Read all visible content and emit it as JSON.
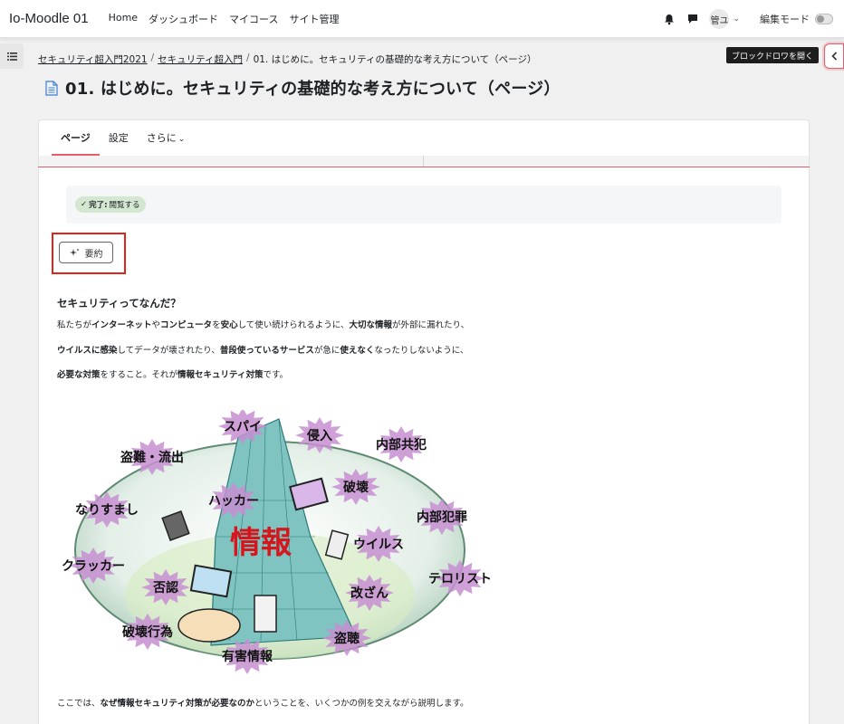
{
  "navbar": {
    "brand": "Io-Moodle 01",
    "links": [
      "Home",
      "ダッシュボード",
      "マイコース",
      "サイト管理"
    ],
    "avatar_text": "管ユ",
    "edit_mode_label": "編集モード"
  },
  "drawer": {
    "block_tooltip": "ブロックドロワを開く"
  },
  "breadcrumb": {
    "items": [
      "セキュリティ超入門2021",
      "セキュリティ超入門",
      "01. はじめに。セキュリティの基礎的な考え方について（ページ）"
    ],
    "separator": "/"
  },
  "page": {
    "title": "01. はじめに。セキュリティの基礎的な考え方について（ページ）"
  },
  "tabs": {
    "items": [
      "ページ",
      "設定",
      "さらに"
    ],
    "more_chevron": "⌄"
  },
  "completion": {
    "check": "✓",
    "label": "完了:",
    "value": "閲覧する"
  },
  "summary": {
    "label": "要約"
  },
  "content": {
    "heading": "セキュリティってなんだ？",
    "p1": {
      "s1": "私たちが",
      "b1": "インターネット",
      "s2": "や",
      "b2": "コンピュータ",
      "s3": "を",
      "b3": "安心",
      "s4": "して使い続けられるように、",
      "b4": "大切な情報",
      "s5": "が外部に漏れたり、"
    },
    "p2": {
      "b1": "ウイルスに感染",
      "s1": "してデータが壊されたり、",
      "b2": "普段使っているサービス",
      "s2": "が急に",
      "b3": "使えなく",
      "s3": "なったりしないように、"
    },
    "p3": {
      "b1": "必要な対策",
      "s1": "をすること。それが",
      "b2": "情報セキュリティ対策",
      "s2": "です。"
    },
    "footer": {
      "s1": "ここでは、",
      "b1": "なぜ情報セキュリティ対策が必要なのか",
      "s2": "ということを、いくつかの例を交えながら説明します。"
    }
  },
  "illustration": {
    "center": "情報",
    "threats": [
      "スパイ",
      "侵入",
      "内部共犯",
      "盗難・流出",
      "ハッカー",
      "破壊",
      "なりすまし",
      "内部犯罪",
      "ウイルス",
      "クラッカー",
      "否認",
      "テロリスト",
      "改ざん",
      "破壊行為",
      "有害情報",
      "盗聴"
    ]
  },
  "colors": {
    "accent": "#e35d6a",
    "highlight": "#e0241b",
    "center_text": "#d6161d",
    "burst": "#c78fd1",
    "badge": "#d4e8d1"
  }
}
